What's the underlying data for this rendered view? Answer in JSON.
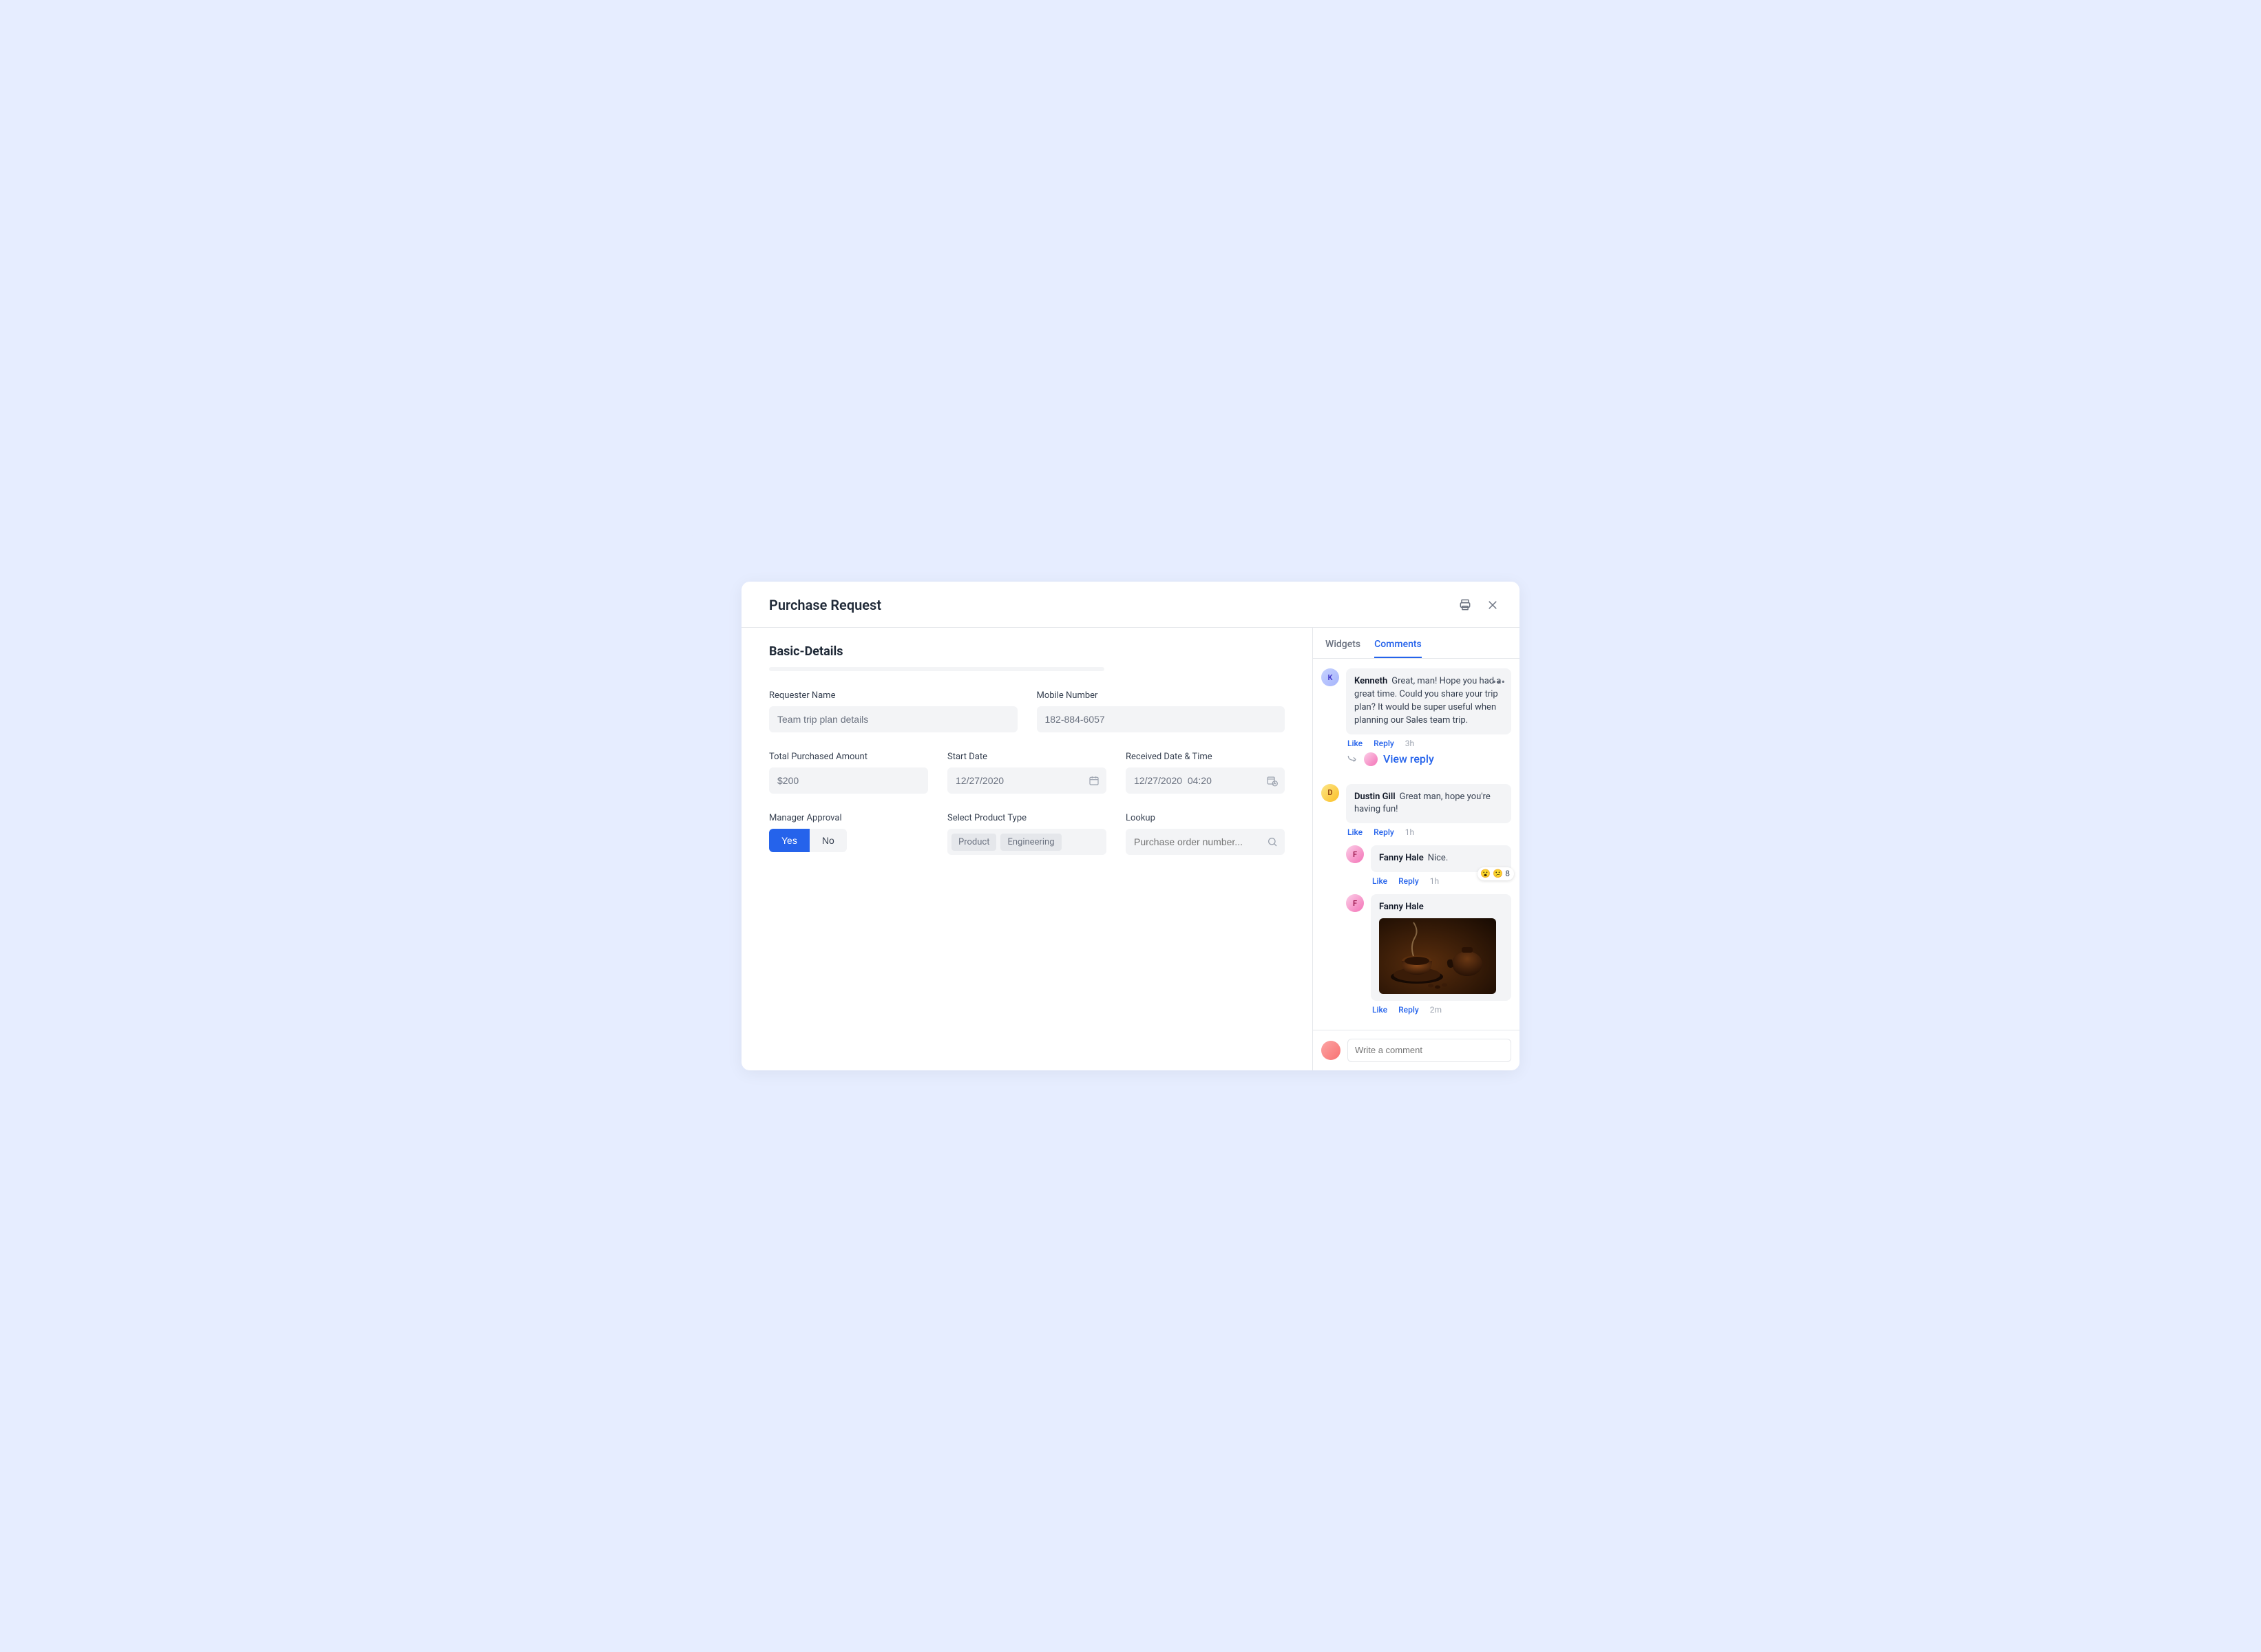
{
  "header": {
    "title": "Purchase Request"
  },
  "section": {
    "title": "Basic-Details"
  },
  "form": {
    "requester_name": {
      "label": "Requester Name",
      "value": "Team trip plan details"
    },
    "mobile_number": {
      "label": "Mobile Number",
      "value": "182-884-6057"
    },
    "total_amount": {
      "label": "Total Purchased Amount",
      "value": "$200"
    },
    "start_date": {
      "label": "Start Date",
      "value": "12/27/2020"
    },
    "received_dt": {
      "label": "Received Date & Time",
      "value": "12/27/2020  04:20"
    },
    "manager_approval": {
      "label": "Manager Approval",
      "yes": "Yes",
      "no": "No"
    },
    "product_type": {
      "label": "Select Product Type",
      "chips": [
        "Product",
        "Engineering"
      ]
    },
    "lookup": {
      "label": "Lookup",
      "placeholder": "Purchase order number..."
    }
  },
  "side": {
    "tabs": {
      "widgets": "Widgets",
      "comments": "Comments"
    },
    "viewReply": "View reply",
    "actions": {
      "like": "Like",
      "reply": "Reply"
    },
    "composer": {
      "placeholder": "Write a comment"
    },
    "comments": [
      {
        "author": "Kenneth",
        "text": "Great, man! Hope you had a great time. Could you share your trip plan? It would be super useful when planning our Sales team trip.",
        "time": "3h"
      },
      {
        "author": "Dustin Gill",
        "text": "Great man, hope you're having fun!",
        "time": "1h"
      },
      {
        "author": "Fanny Hale",
        "text": "Nice.",
        "time": "1h",
        "reactionCount": "8"
      },
      {
        "author": "Fanny Hale",
        "text": "",
        "time": "2m"
      }
    ]
  }
}
